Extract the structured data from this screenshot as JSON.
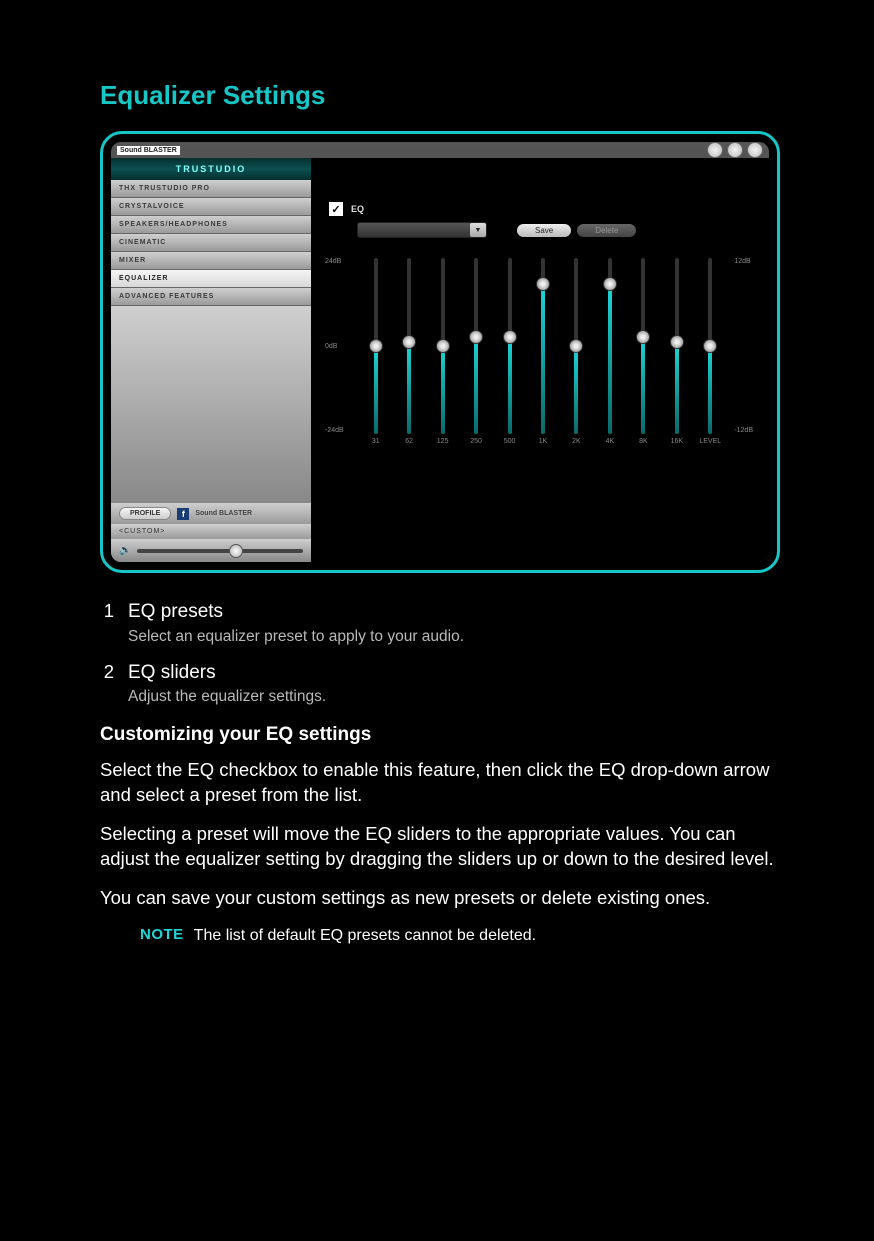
{
  "page": {
    "title": "Equalizer Settings"
  },
  "screenshot": {
    "app_logo": "Sound BLASTER",
    "brand_tab": "TRUSTUDIO",
    "menu": [
      "THX TRUSTUDIO PRO",
      "CRYSTALVOICE",
      "SPEAKERS/HEADPHONES",
      "CINEMATIC",
      "MIXER",
      "EQUALIZER",
      "ADVANCED FEATURES"
    ],
    "menu_active_index": 5,
    "profile_button": "PROFILE",
    "footer_logo": "Sound BLASTER",
    "custom_label": "<CUSTOM>",
    "eq_checkbox_checked": true,
    "eq_label": "EQ",
    "save_button": "Save",
    "delete_button": "Delete",
    "db_left": [
      "24dB",
      "0dB",
      "-24dB"
    ],
    "db_right": [
      "12dB",
      "-12dB"
    ],
    "sliders": [
      {
        "freq": "31",
        "pct": 50
      },
      {
        "freq": "62",
        "pct": 52
      },
      {
        "freq": "125",
        "pct": 50
      },
      {
        "freq": "250",
        "pct": 55
      },
      {
        "freq": "500",
        "pct": 55
      },
      {
        "freq": "1K",
        "pct": 85
      },
      {
        "freq": "2K",
        "pct": 50
      },
      {
        "freq": "4K",
        "pct": 85
      },
      {
        "freq": "8K",
        "pct": 55
      },
      {
        "freq": "16K",
        "pct": 52
      },
      {
        "freq": "LEVEL",
        "pct": 50
      }
    ]
  },
  "doc": {
    "items": [
      {
        "num": "1",
        "title": "EQ presets",
        "desc": "Select an equalizer preset to apply to your audio."
      },
      {
        "num": "2",
        "title": "EQ sliders",
        "desc": "Adjust the equalizer settings."
      }
    ],
    "subhead": "Customizing your EQ settings",
    "paras": [
      "Select the EQ checkbox to enable this feature, then click the EQ drop-down arrow and select a preset from the list.",
      "Selecting a preset will move the EQ sliders to the appropriate values. You can adjust the equalizer setting by dragging the sliders up or down to the desired level.",
      "You can save your custom settings as new presets or delete existing ones."
    ],
    "note_label": "NOTE",
    "note_text": "The list of default EQ presets cannot be deleted."
  }
}
